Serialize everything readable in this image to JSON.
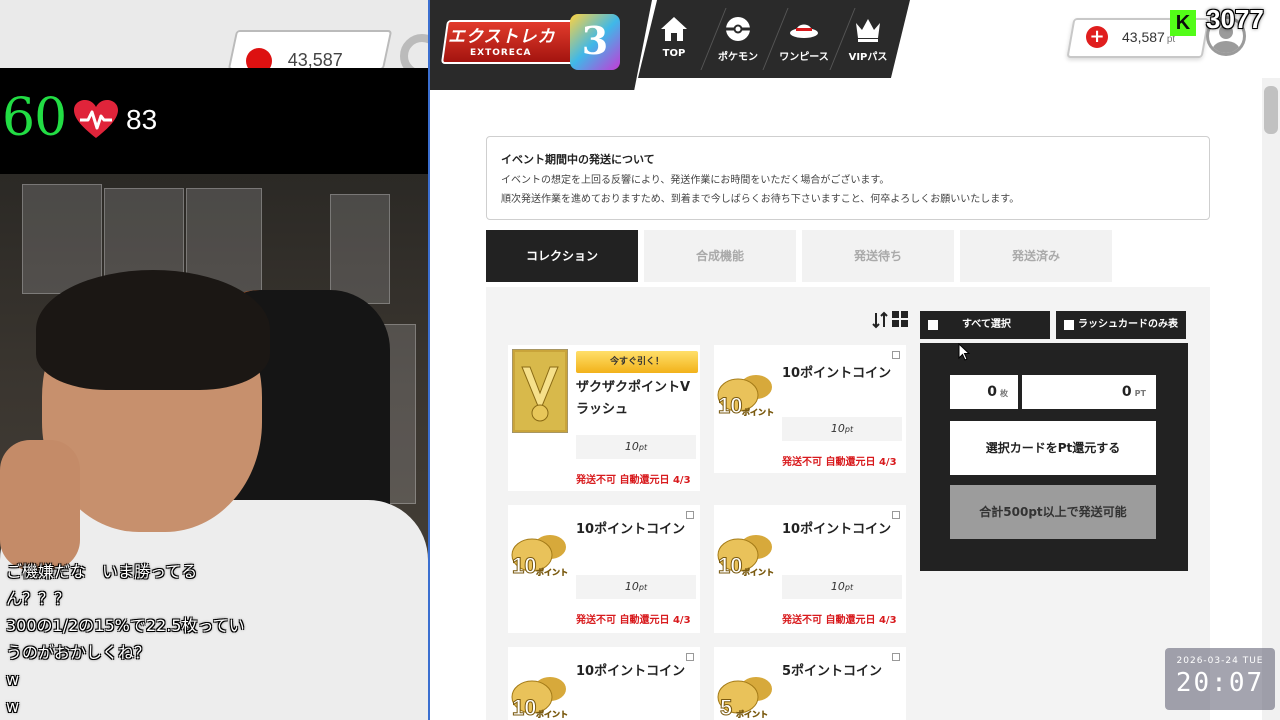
{
  "stream": {
    "bpm": "60",
    "heart_value": "83",
    "chat": [
      "ご機嫌だな　いま勝ってる",
      "ん？？？",
      "300の1/2の15%で22.5枚ってい",
      "うのがおかしくね？",
      "w",
      "w"
    ],
    "viewer_count": "3077",
    "platform_badge": "K",
    "date": "2026-03-24 TUE",
    "time": "20:07"
  },
  "site": {
    "logo_text": "エクストレカ",
    "logo_sub": "EXTORECA",
    "logo_anniv": "3",
    "nav": [
      {
        "label": "TOP",
        "icon": "home-icon"
      },
      {
        "label": "ポケモン",
        "icon": "pokeball-icon"
      },
      {
        "label": "ワンピース",
        "icon": "straw-hat-icon"
      },
      {
        "label": "VIPパス",
        "icon": "crown-icon"
      }
    ],
    "points": "43,587",
    "points_unit": "pt",
    "points_plus": "+"
  },
  "notice": {
    "title": "イベント期間中の発送について",
    "lines": [
      "イベントの想定を上回る反響により、発送作業にお時間をいただく場合がございます。",
      "順次発送作業を進めておりますため、到着まで今しばらくお待ち下さいますこと、何卒よろしくお願いいたします。"
    ]
  },
  "tabs": [
    "コレクション",
    "合成機能",
    "発送待ち",
    "発送済み"
  ],
  "toolbar": {
    "select_all": "すべて選択",
    "rush_only": "ラッシュカードのみ表示"
  },
  "cards": [
    {
      "badge": "今すぐ引く！",
      "name": "ザクザクポイントVラッシュ",
      "price": "10",
      "unit": "pt",
      "status": "発送不可 自動還元日 4/3",
      "coin_label": ""
    },
    {
      "badge": "",
      "name": "10ポイントコイン",
      "price": "10",
      "unit": "pt",
      "status": "発送不可 自動還元日 4/3",
      "coin_label": "10ポイント"
    },
    {
      "badge": "",
      "name": "10ポイントコイン",
      "price": "10",
      "unit": "pt",
      "status": "発送不可 自動還元日 4/3",
      "coin_label": "10ポイント"
    },
    {
      "badge": "",
      "name": "10ポイントコイン",
      "price": "10",
      "unit": "pt",
      "status": "発送不可 自動還元日 4/3",
      "coin_label": "10ポイント"
    },
    {
      "badge": "",
      "name": "10ポイントコイン",
      "price": "",
      "unit": "",
      "status": "",
      "coin_label": "10ポイント"
    },
    {
      "badge": "",
      "name": "5ポイントコイン",
      "price": "",
      "unit": "",
      "status": "",
      "coin_label": "5ポイント"
    }
  ],
  "panel": {
    "count": "0",
    "count_unit": "枚",
    "points": "0",
    "points_unit": "PT",
    "return_button": "選択カードをPt還元する",
    "ship_button": "合計500pt以上で発送可能"
  },
  "colors": {
    "accent_red": "#d8191c",
    "kick_green": "#53fc18",
    "dark": "#222222",
    "bpm_green": "#22dd44"
  }
}
